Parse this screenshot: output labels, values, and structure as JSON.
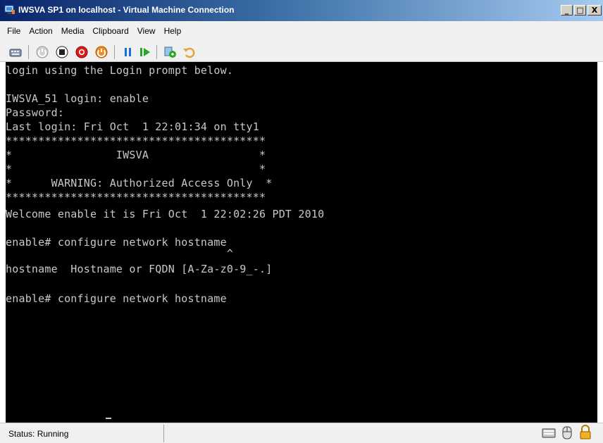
{
  "window": {
    "title": "IWSVA SP1 on localhost - Virtual Machine Connection",
    "buttons": {
      "minimize": "_",
      "maximize": "□",
      "close": "X"
    }
  },
  "menu": [
    "File",
    "Action",
    "Media",
    "Clipboard",
    "View",
    "Help"
  ],
  "toolbar": {
    "icons": [
      "ctrl-alt-del-icon",
      "start-icon",
      "turn-off-icon",
      "shutdown-icon",
      "save-icon",
      "pause-icon",
      "reset-icon",
      "snapshot-icon",
      "revert-icon"
    ]
  },
  "console": {
    "lines": [
      "login using the Login prompt below.",
      "",
      "IWSVA_51 login: enable",
      "Password:",
      "Last login: Fri Oct  1 22:01:34 on tty1",
      "****************************************",
      "*                IWSVA                 *",
      "*                                      *",
      "*      WARNING: Authorized Access Only  *",
      "****************************************",
      "Welcome enable it is Fri Oct  1 22:02:26 PDT 2010",
      "",
      "enable# configure network hostname",
      "                                  ^",
      "hostname  Hostname or FQDN [A-Za-z0-9_-.]",
      "",
      "enable# configure network hostname"
    ]
  },
  "status": {
    "text": "Status: Running"
  },
  "colors": {
    "console_bg": "#000000",
    "console_fg": "#c8c8c8",
    "titlebar_start": "#0a246a",
    "titlebar_end": "#a6caf0"
  }
}
